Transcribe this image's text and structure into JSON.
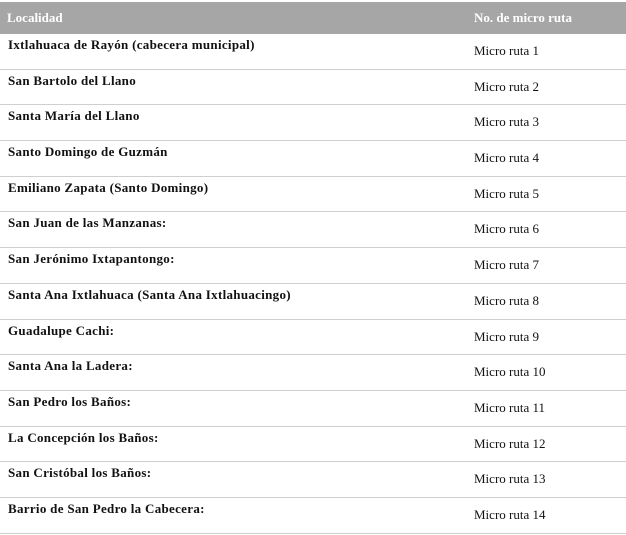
{
  "table": {
    "headers": {
      "localidad": "Localidad",
      "ruta": "No. de micro ruta"
    },
    "rows": [
      {
        "localidad": "Ixtlahuaca de Rayón (cabecera municipal)",
        "ruta": "Micro ruta 1"
      },
      {
        "localidad": "San Bartolo del Llano",
        "ruta": "Micro ruta 2"
      },
      {
        "localidad": "Santa María del Llano",
        "ruta": "Micro ruta 3"
      },
      {
        "localidad": "Santo Domingo de Guzmán",
        "ruta": "Micro ruta 4"
      },
      {
        "localidad": "Emiliano Zapata (Santo Domingo)",
        "ruta": "Micro ruta 5"
      },
      {
        "localidad": "San Juan de las Manzanas:",
        "ruta": "Micro ruta 6"
      },
      {
        "localidad": "San Jerónimo Ixtapantongo:",
        "ruta": "Micro ruta 7"
      },
      {
        "localidad": "Santa Ana Ixtlahuaca (Santa Ana Ixtlahuacingo)",
        "ruta": "Micro ruta 8"
      },
      {
        "localidad": "Guadalupe Cachi:",
        "ruta": "Micro ruta 9"
      },
      {
        "localidad": "Santa Ana la Ladera:",
        "ruta": "Micro ruta 10"
      },
      {
        "localidad": "San Pedro los Baños:",
        "ruta": "Micro ruta 11"
      },
      {
        "localidad": "La Concepción los Baños:",
        "ruta": "Micro ruta 12"
      },
      {
        "localidad": "San Cristóbal los Baños:",
        "ruta": "Micro ruta 13"
      },
      {
        "localidad": "Barrio de San Pedro la Cabecera:",
        "ruta": "Micro ruta 14"
      }
    ]
  },
  "colors": {
    "header_bg": "#a6a6a6",
    "header_text": "#ffffff",
    "row_divider": "#cfcfcf"
  }
}
